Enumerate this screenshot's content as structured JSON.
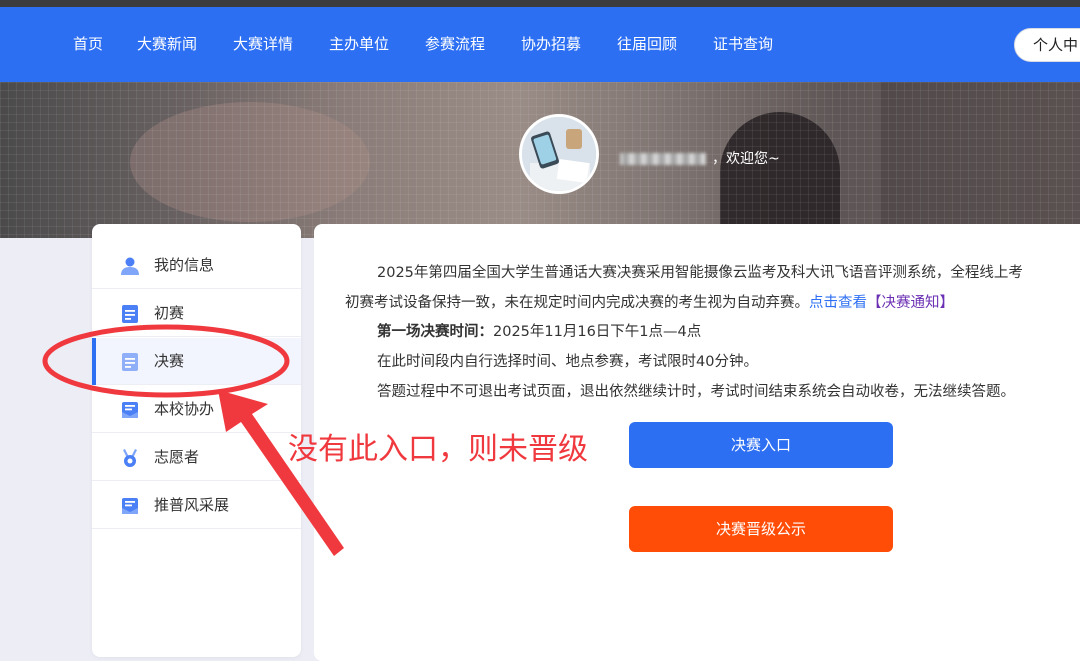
{
  "nav": {
    "items": [
      "首页",
      "大赛新闻",
      "大赛详情",
      "主办单位",
      "参赛流程",
      "协办招募",
      "往届回顾",
      "证书查询"
    ],
    "user_center": "个人中"
  },
  "banner": {
    "welcome_suffix": "，欢迎您~"
  },
  "sidebar": {
    "items": [
      {
        "label": "我的信息",
        "icon": "user-icon"
      },
      {
        "label": "初赛",
        "icon": "document-icon"
      },
      {
        "label": "决赛",
        "icon": "document-icon"
      },
      {
        "label": "本校协办",
        "icon": "mail-icon"
      },
      {
        "label": "志愿者",
        "icon": "medal-icon"
      },
      {
        "label": "推普风采展",
        "icon": "mail-icon"
      }
    ],
    "active": "决赛"
  },
  "main": {
    "intro_line1": "2025年第四届全国大学生普通话大赛决赛采用智能摄像云监考及科大讯飞语音评测系统，全程线上考",
    "intro_line2": "初赛考试设备保持一致，未在规定时间内完成决赛的考生视为自动弃赛。",
    "intro_link": "点击查看",
    "intro_link2": "【决赛通知】",
    "round_label": "第一场决赛时间：",
    "round_time": "2025年11月16日下午1点—4点",
    "note1": "在此时间段内自行选择时间、地点参赛，考试限时40分钟。",
    "note2": "答题过程中不可退出考试页面，退出依然继续计时，考试时间结束系统会自动收卷，无法继续答题。",
    "btn_entry": "决赛入口",
    "btn_promote": "决赛晋级公示"
  },
  "annotation": {
    "text": "没有此入口，则未晋级"
  },
  "colors": {
    "nav": "#2d6ff2",
    "primary_button": "#2d6ff2",
    "secondary_button": "#ff4d07",
    "annotation": "#f0393e"
  }
}
